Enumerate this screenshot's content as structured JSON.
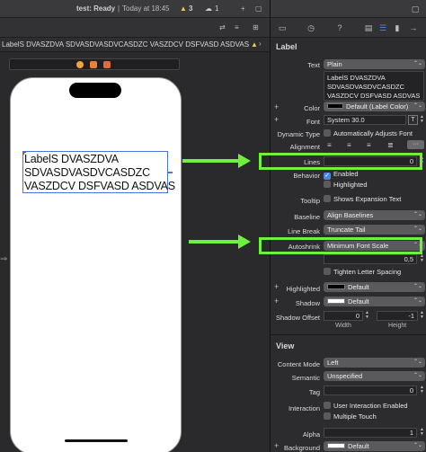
{
  "canvas": {
    "status": "test: Ready",
    "status_time": "Today at 18:45",
    "warnings": "3",
    "cloud": "1",
    "jump_path": "LabelS DVASZDVA SDVASDVASDVCASDZC VASZDCV DSFVASD ASDVAS",
    "label_text_lines": [
      "LabelS DVASZDVA",
      "SDVASDVASDVCASDZC",
      "VASZDCV DSFVASD ASDVAS"
    ]
  },
  "inspector": {
    "label_section_title": "Label",
    "text_row_label": "Text",
    "text_type": "Plain",
    "text_value_lines": [
      "LabelS DVASZDVA",
      "SDVASDVASDVCASDZC",
      "VASZDCV DSFVASD ASDVAS"
    ],
    "color_row_label": "Color",
    "color_value": "Default (Label Color)",
    "font_row_label": "Font",
    "font_value": "System 30.0",
    "dynamic_type_label": "Dynamic Type",
    "dynamic_type_value": "Automatically Adjusts Font",
    "alignment_label": "Alignment",
    "lines_label": "Lines",
    "lines_value": "0",
    "behavior_label": "Behavior",
    "enabled_label": "Enabled",
    "highlighted_check_label": "Highlighted",
    "tooltip_label": "Tooltip",
    "tooltip_value": "Shows Expansion Text",
    "baseline_label": "Baseline",
    "baseline_value": "Align Baselines",
    "line_break_label": "Line Break",
    "line_break_value": "Truncate Tail",
    "autoshrink_label": "Autoshrink",
    "autoshrink_value": "Minimum Font Scale",
    "min_scale_value": "0,5",
    "tighten_label": "Tighten Letter Spacing",
    "highlighted_label": "Highlighted",
    "highlighted_value": "Default",
    "shadow_label": "Shadow",
    "shadow_value": "Default",
    "shadow_offset_label": "Shadow Offset",
    "shadow_offset_w": "0",
    "shadow_offset_h": "-1",
    "width_label": "Width",
    "height_label": "Height",
    "view_section_title": "View",
    "content_mode_label": "Content Mode",
    "content_mode_value": "Left",
    "semantic_label": "Semantic",
    "semantic_value": "Unspecified",
    "tag_label": "Tag",
    "tag_value": "0",
    "interaction_label": "Interaction",
    "user_interaction_label": "User Interaction Enabled",
    "multiple_touch_label": "Multiple Touch",
    "alpha_label": "Alpha",
    "alpha_value": "1",
    "background_label": "Background",
    "background_value": "Default"
  },
  "colors": {
    "annotation_green": "#6ef03c",
    "selection_blue": "#4a76d8"
  }
}
